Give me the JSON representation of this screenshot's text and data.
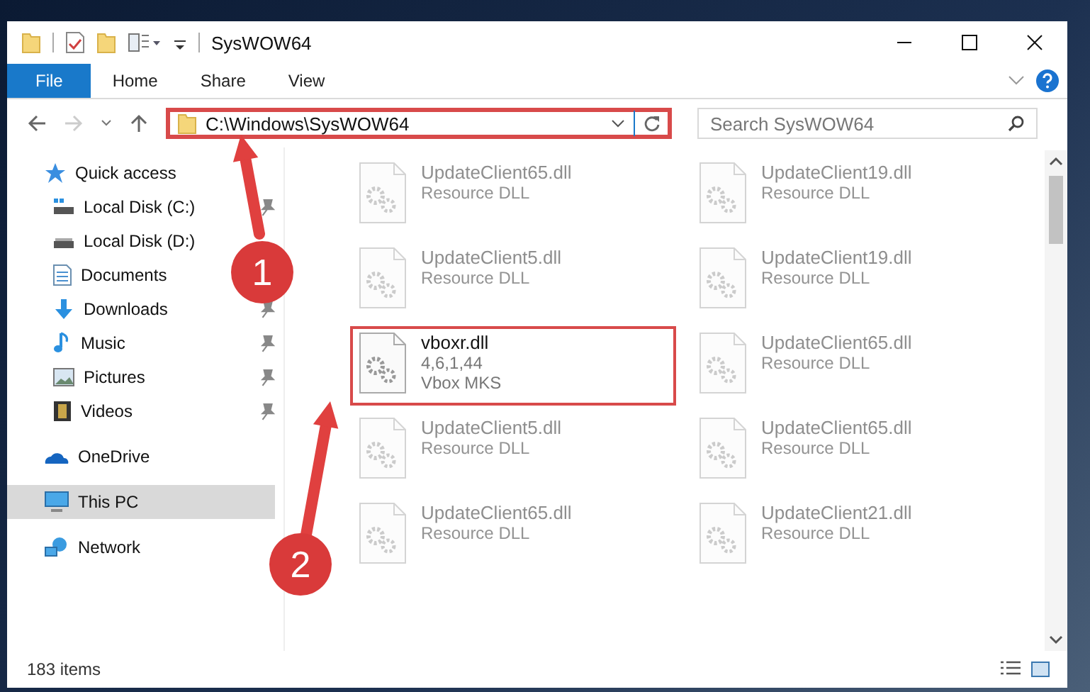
{
  "window": {
    "title": "SysWOW64"
  },
  "ribbon_tabs": [
    {
      "label": "File",
      "selected": true
    },
    {
      "label": "Home",
      "selected": false
    },
    {
      "label": "Share",
      "selected": false
    },
    {
      "label": "View",
      "selected": false
    }
  ],
  "navigation": {
    "back_disabled": false,
    "forward_disabled": true
  },
  "address_bar": {
    "path": "C:\\Windows\\SysWOW64",
    "highlighted": true
  },
  "search": {
    "placeholder": "Search SysWOW64"
  },
  "sidebar": {
    "items": [
      {
        "label": "Quick access",
        "kind": "star",
        "selected": false,
        "children": [
          {
            "label": "Local Disk (C:)",
            "kind": "drive-c",
            "pinned": true,
            "selected": false
          },
          {
            "label": "Local Disk (D:)",
            "kind": "drive",
            "pinned": false,
            "selected": false
          },
          {
            "label": "Documents",
            "kind": "documents",
            "pinned": false,
            "selected": false
          },
          {
            "label": "Downloads",
            "kind": "downloads",
            "pinned": true,
            "selected": false
          },
          {
            "label": "Music",
            "kind": "music",
            "pinned": true,
            "selected": false
          },
          {
            "label": "Pictures",
            "kind": "pictures",
            "pinned": true,
            "selected": false
          },
          {
            "label": "Videos",
            "kind": "videos",
            "pinned": true,
            "selected": false
          }
        ]
      },
      {
        "label": "OneDrive",
        "kind": "cloud",
        "selected": false
      },
      {
        "label": "This PC",
        "kind": "pc",
        "selected": true
      },
      {
        "label": "Network",
        "kind": "network",
        "selected": false
      }
    ]
  },
  "files": [
    {
      "name": "UpdateClient65.dll",
      "lines": [
        "Resource DLL"
      ],
      "faded": true,
      "highlighted": false
    },
    {
      "name": "UpdateClient19.dll",
      "lines": [
        "Resource DLL"
      ],
      "faded": true,
      "highlighted": false
    },
    {
      "name": "UpdateClient5.dll",
      "lines": [
        "Resource DLL"
      ],
      "faded": true,
      "highlighted": false
    },
    {
      "name": "UpdateClient19.dll",
      "lines": [
        "Resource DLL"
      ],
      "faded": true,
      "highlighted": false
    },
    {
      "name": "vboxr.dll",
      "lines": [
        "4,6,1,44",
        "Vbox MKS"
      ],
      "faded": false,
      "highlighted": true
    },
    {
      "name": "UpdateClient65.dll",
      "lines": [
        "Resource DLL"
      ],
      "faded": true,
      "highlighted": false
    },
    {
      "name": "UpdateClient5.dll",
      "lines": [
        "Resource DLL"
      ],
      "faded": true,
      "highlighted": false
    },
    {
      "name": "UpdateClient65.dll",
      "lines": [
        "Resource DLL"
      ],
      "faded": true,
      "highlighted": false
    },
    {
      "name": "UpdateClient65.dll",
      "lines": [
        "Resource DLL"
      ],
      "faded": true,
      "highlighted": false
    },
    {
      "name": "UpdateClient21.dll",
      "lines": [
        "Resource DLL"
      ],
      "faded": true,
      "highlighted": false
    }
  ],
  "annotations": [
    {
      "number": "1"
    },
    {
      "number": "2"
    }
  ],
  "status_bar": {
    "item_count": "183 items"
  }
}
